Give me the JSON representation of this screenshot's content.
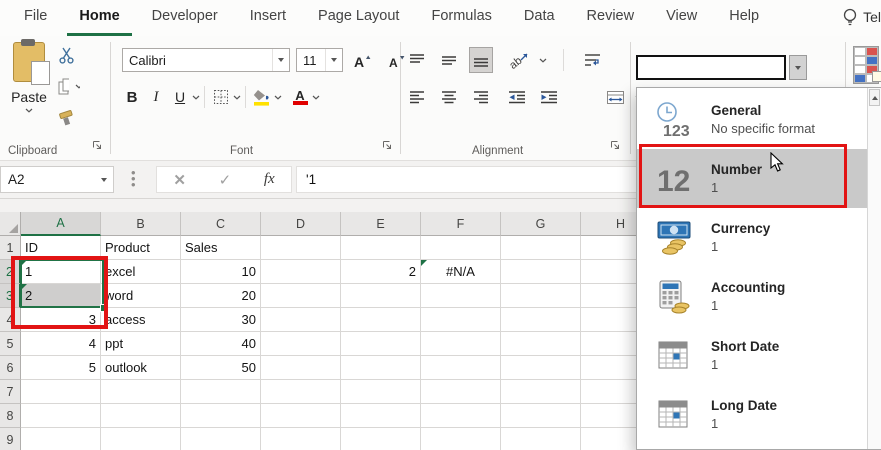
{
  "window": {
    "tell_me_label": "Tel"
  },
  "tabs": [
    {
      "label": "File",
      "active": false
    },
    {
      "label": "Home",
      "active": true
    },
    {
      "label": "Developer",
      "active": false
    },
    {
      "label": "Insert",
      "active": false
    },
    {
      "label": "Page Layout",
      "active": false
    },
    {
      "label": "Formulas",
      "active": false
    },
    {
      "label": "Data",
      "active": false
    },
    {
      "label": "Review",
      "active": false
    },
    {
      "label": "View",
      "active": false
    },
    {
      "label": "Help",
      "active": false
    }
  ],
  "ribbon": {
    "clipboard": {
      "group_label": "Clipboard",
      "paste_label": "Paste",
      "icons": [
        "clipboard-paste-icon",
        "cut-icon",
        "copy-icon",
        "format-painter-icon"
      ]
    },
    "font": {
      "group_label": "Font",
      "font_name": "Calibri",
      "font_size": "11",
      "bold_label": "B",
      "italic_label": "I",
      "underline_label": "U",
      "icons": [
        "grow-font-icon",
        "shrink-font-icon",
        "borders-icon",
        "fill-color-icon",
        "font-color-icon"
      ],
      "fill_color": "#ffe100",
      "font_color": "#e00000"
    },
    "alignment": {
      "group_label": "Alignment",
      "icons": [
        "align-top-icon",
        "align-middle-icon",
        "align-bottom-icon",
        "orientation-icon",
        "wrap-text-icon",
        "align-left-icon",
        "align-center-icon",
        "align-right-icon",
        "decrease-indent-icon",
        "increase-indent-icon",
        "merge-center-icon"
      ],
      "selected": "align-bottom"
    },
    "number": {
      "format_box_value": ""
    },
    "styles": {
      "icons": [
        "conditional-formatting-icon"
      ]
    }
  },
  "formula_bar": {
    "name_box_value": "A2",
    "cancel_glyph": "✕",
    "enter_glyph": "✓",
    "fx_label": "fx",
    "formula_value": "'1"
  },
  "sheet": {
    "column_headers": [
      "A",
      "B",
      "C",
      "D",
      "E",
      "F",
      "G",
      "H"
    ],
    "selected_column": "A",
    "selected_rows": [
      "2",
      "3"
    ],
    "rows": [
      {
        "n": "1",
        "cells": [
          {
            "col": "A",
            "v": "ID",
            "align": "left"
          },
          {
            "col": "B",
            "v": "Product",
            "align": "left"
          },
          {
            "col": "C",
            "v": "Sales",
            "align": "left"
          }
        ]
      },
      {
        "n": "2",
        "cells": [
          {
            "col": "A",
            "v": "1",
            "align": "left",
            "flag": true
          },
          {
            "col": "B",
            "v": "excel",
            "align": "left"
          },
          {
            "col": "C",
            "v": "10",
            "align": "right"
          },
          {
            "col": "E",
            "v": "2",
            "align": "right"
          },
          {
            "col": "F",
            "v": "#N/A",
            "align": "center",
            "flag": true
          }
        ]
      },
      {
        "n": "3",
        "cells": [
          {
            "col": "A",
            "v": "2",
            "align": "left",
            "flag": true,
            "selected": true
          },
          {
            "col": "B",
            "v": "word",
            "align": "left"
          },
          {
            "col": "C",
            "v": "20",
            "align": "right"
          }
        ]
      },
      {
        "n": "4",
        "cells": [
          {
            "col": "A",
            "v": "3",
            "align": "right"
          },
          {
            "col": "B",
            "v": "access",
            "align": "left"
          },
          {
            "col": "C",
            "v": "30",
            "align": "right"
          }
        ]
      },
      {
        "n": "5",
        "cells": [
          {
            "col": "A",
            "v": "4",
            "align": "right"
          },
          {
            "col": "B",
            "v": "ppt",
            "align": "left"
          },
          {
            "col": "C",
            "v": "40",
            "align": "right"
          }
        ]
      },
      {
        "n": "6",
        "cells": [
          {
            "col": "A",
            "v": "5",
            "align": "right"
          },
          {
            "col": "B",
            "v": "outlook",
            "align": "left"
          },
          {
            "col": "C",
            "v": "50",
            "align": "right"
          }
        ]
      },
      {
        "n": "7",
        "cells": []
      },
      {
        "n": "8",
        "cells": []
      },
      {
        "n": "9",
        "cells": []
      }
    ]
  },
  "format_dropdown": {
    "items": [
      {
        "title": "General",
        "subtitle": "No specific format",
        "icon": "general-format-icon",
        "highlighted": false
      },
      {
        "title": "Number",
        "subtitle": "1",
        "icon": "number-format-icon",
        "highlighted": true
      },
      {
        "title": "Currency",
        "subtitle": "1",
        "icon": "currency-format-icon",
        "highlighted": false
      },
      {
        "title": "Accounting",
        "subtitle": "1",
        "icon": "accounting-format-icon",
        "highlighted": false
      },
      {
        "title": "Short Date",
        "subtitle": "1",
        "icon": "short-date-format-icon",
        "highlighted": false
      },
      {
        "title": "Long Date",
        "subtitle": "1",
        "icon": "long-date-format-icon",
        "highlighted": false
      }
    ]
  },
  "colors": {
    "accent_green": "#1e7145",
    "selection_green": "#217346",
    "annotation_red": "#e21414",
    "highlight_gray": "#c9c9c9",
    "selected_cell_fill": "#cfcecd"
  }
}
